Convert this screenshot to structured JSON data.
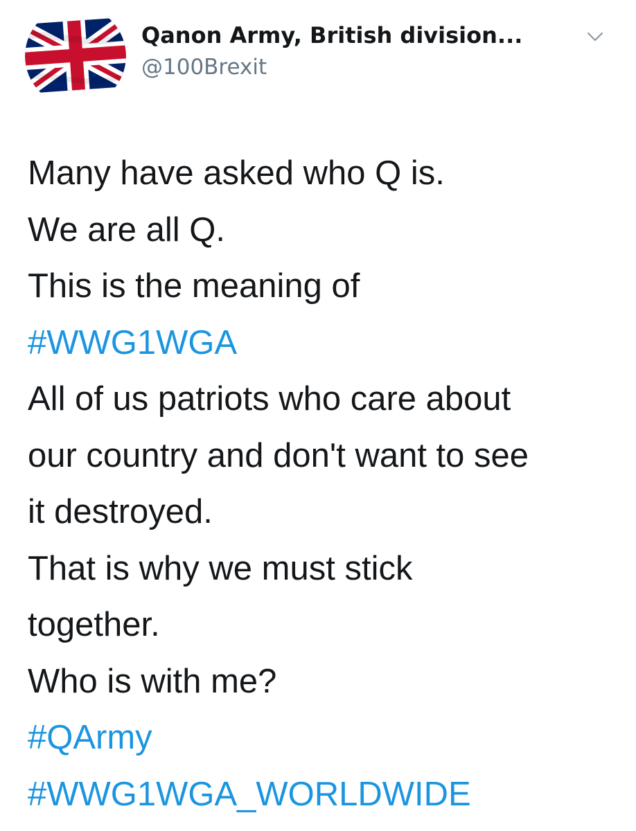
{
  "user": {
    "avatar_icon": "union-jack-flag-avatar",
    "display_name": "Qanon Army, British division...",
    "handle": "@100Brexit"
  },
  "menu": {
    "icon": "chevron-down-icon"
  },
  "tweet": {
    "lines": [
      {
        "text": "Many have asked who Q is.",
        "hashtag": false
      },
      {
        "text": "We are all Q.",
        "hashtag": false
      },
      {
        "text": "This is the meaning of",
        "hashtag": false
      },
      {
        "text": "#WWG1WGA",
        "hashtag": true
      },
      {
        "text": "All of us patriots who care about",
        "hashtag": false
      },
      {
        "text": "our country and don't want to see",
        "hashtag": false
      },
      {
        "text": "it destroyed.",
        "hashtag": false
      },
      {
        "text": "That is why we must stick",
        "hashtag": false
      },
      {
        "text": "together.",
        "hashtag": false
      },
      {
        "text": "Who is with me?",
        "hashtag": false
      },
      {
        "text": "#QArmy",
        "hashtag": true
      },
      {
        "text": "#WWG1WGA_WORLDWIDE",
        "hashtag": true
      }
    ]
  },
  "colors": {
    "text": "#14171a",
    "secondary_text": "#657786",
    "hashtag": "#1b95e0",
    "flag_blue": "#012169",
    "flag_red": "#C8102E",
    "flag_white": "#ffffff"
  }
}
